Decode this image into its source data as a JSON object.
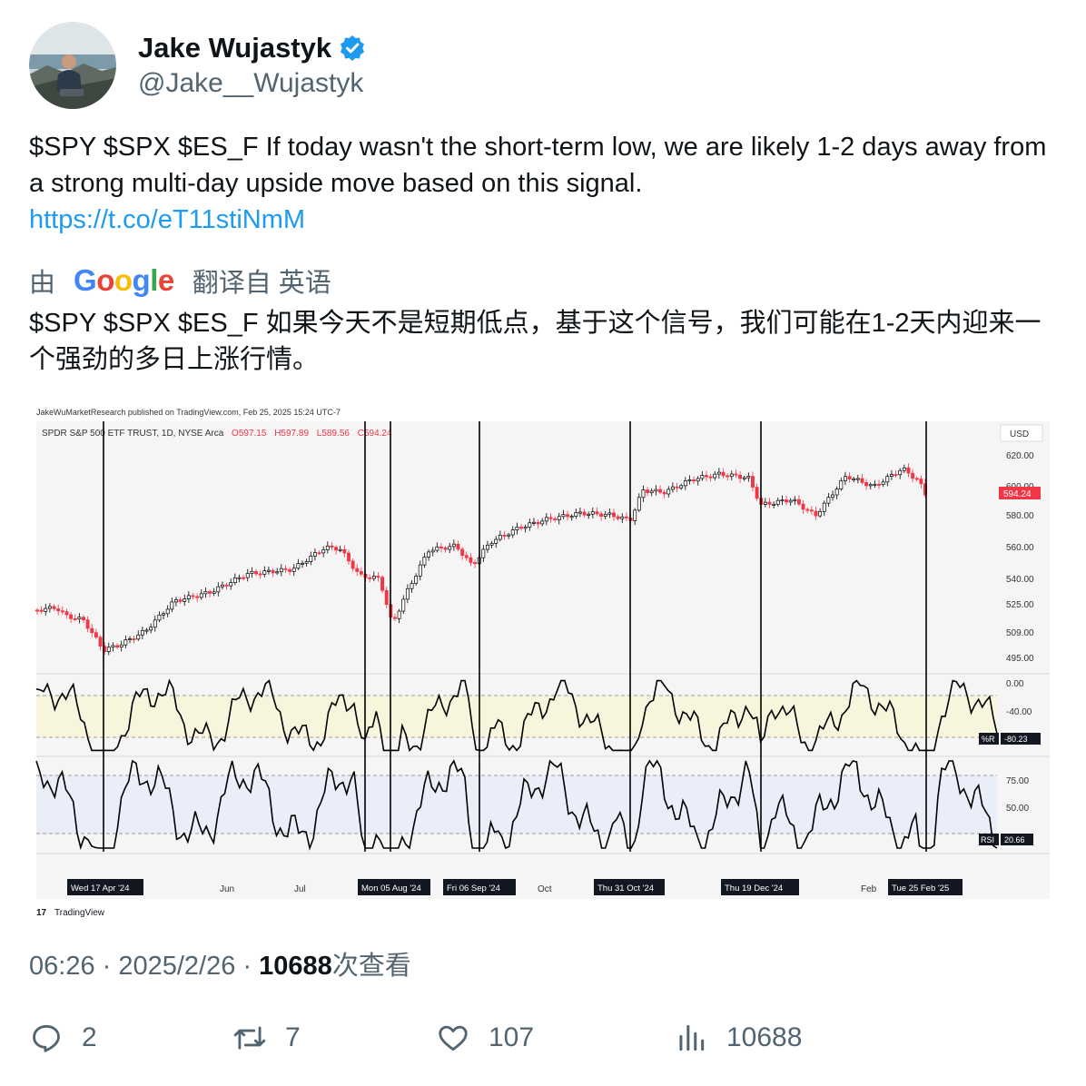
{
  "tweet": {
    "display_name": "Jake Wujastyk",
    "handle": "@Jake__Wujastyk",
    "text": "$SPY $SPX $ES_F If today wasn't the short-term low, we are likely 1-2 days away from a strong multi-day upside move based on this signal.",
    "link": "https://t.co/eT11stiNmM",
    "translate_prefix": "由",
    "translate_brand": "Google",
    "translate_suffix": "翻译自 英语",
    "translated_text": "$SPY $SPX $ES_F 如果今天不是短期低点，基于这个信号，我们可能在1-2天内迎来一个强劲的多日上涨行情。",
    "time": "06:26",
    "date": "2025/2/26",
    "views_count": "10688",
    "views_label": "次查看"
  },
  "actions": {
    "replies": "2",
    "retweets": "7",
    "likes": "107",
    "views": "10688"
  },
  "chart": {
    "publisher_line": "JakeWuMarketResearch published on TradingView.com, Feb 25, 2025 15:24 UTC-7",
    "symbol_line": "SPDR S&P 500 ETF TRUST, 1D, NYSE Arca",
    "ohlc": {
      "o": "O597.15",
      "h": "H597.89",
      "l": "L589.56",
      "c": "C594.24"
    },
    "currency": "USD",
    "price_ticks": [
      "620.00",
      "600.00",
      "580.00",
      "560.00",
      "540.00",
      "525.00",
      "509.00",
      "495.00"
    ],
    "last_price": "594.24",
    "wr_ticks": [
      "0.00",
      "-40.00"
    ],
    "wr_label": "%R",
    "wr_value": "-80.23",
    "rsi_ticks": [
      "75.00",
      "50.00"
    ],
    "rsi_label": "RSI",
    "rsi_value": "20.66",
    "month_labels": [
      "Jun",
      "Jul",
      "Oct",
      "Feb"
    ],
    "signal_dates": [
      "Wed 17 Apr '24",
      "Mon 05 Aug '24",
      "Fri 06 Sep '24",
      "Thu 31 Oct '24",
      "Thu 19 Dec '24",
      "Tue 25 Feb '25"
    ],
    "brand": "TradingView",
    "colors": {
      "up": "#000000",
      "down": "#f23645",
      "wr_band": "#f7f5dc",
      "rsi_band": "#e9eef8",
      "background": "#f5f5f5"
    }
  }
}
